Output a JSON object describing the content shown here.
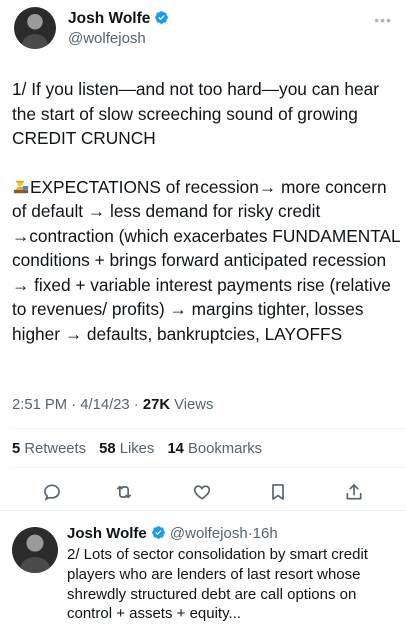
{
  "tweet": {
    "author_name": "Josh Wolfe",
    "handle": "@wolfejosh",
    "more_icon": "more-horizontal-icon",
    "paragraphs": [
      "1/ If you listen—and not too hard—you can hear the start of slow screeching sound of growing CREDIT CRUNCH",
      "EXPECTATIONS of recession→ more concern of default → less demand for risky credit →contraction (which exacerbates FUNDAMENTAL conditions + brings forward anticipated recession → fixed + variable interest payments rise (relative to revenues/ profits) → margins tighter, losses higher → defaults, bankruptcies, LAYOFFS"
    ],
    "emoji": "person-at-desk-emoji",
    "time": "2:51 PM",
    "date": "4/14/23",
    "separator": "·",
    "views_count": "27K",
    "views_label": "Views",
    "stats": {
      "retweets_count": "5",
      "retweets_label": "Retweets",
      "likes_count": "58",
      "likes_label": "Likes",
      "bookmarks_count": "14",
      "bookmarks_label": "Bookmarks"
    },
    "actions": [
      "reply-icon",
      "retweet-icon",
      "like-icon",
      "bookmark-icon",
      "share-icon"
    ]
  },
  "reply": {
    "author_name": "Josh Wolfe",
    "handle": "@wolfejosh",
    "separator": "·",
    "age": "16h",
    "text": "2/ Lots of sector consolidation by smart credit players who are lenders of last resort whose shrewdly structured debt are call options on control + assets + equity..."
  },
  "colors": {
    "text": "#0f1419",
    "secondary": "#536471",
    "verified": "#1d9bf0",
    "icon": "#536471",
    "divider": "#eff3f4"
  }
}
